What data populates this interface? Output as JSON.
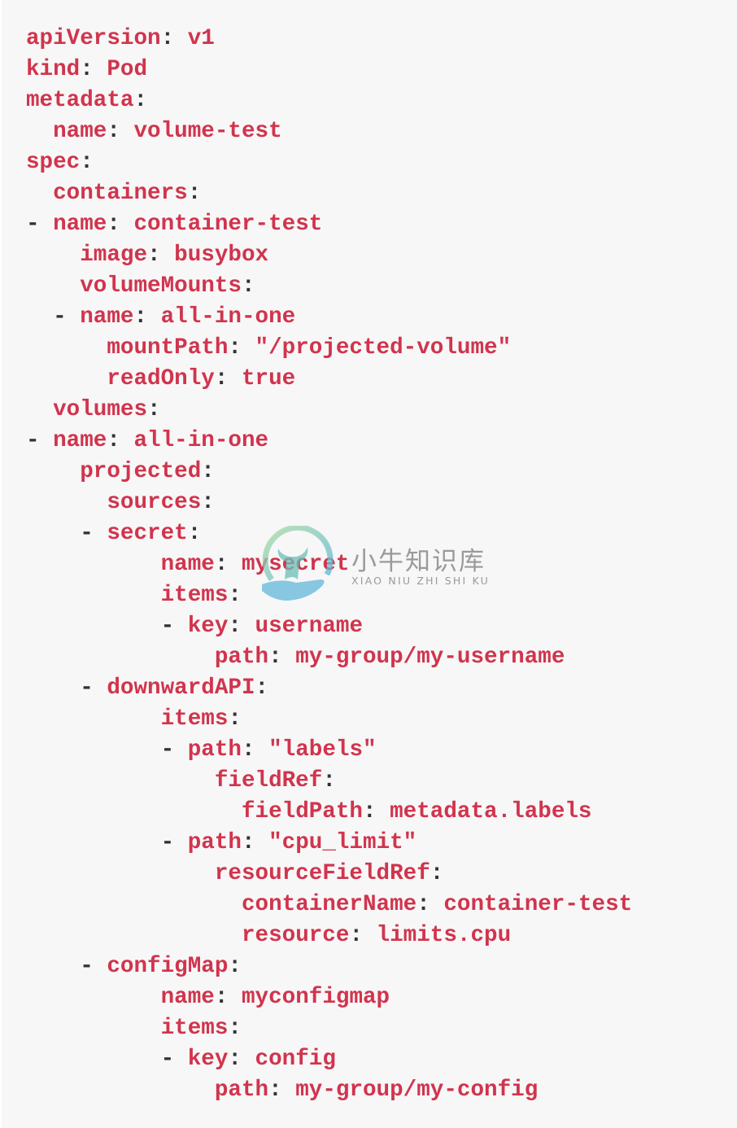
{
  "colors": {
    "key": "#d1344d",
    "value": "#d1344d",
    "punctuation": "#333333",
    "background": "#f7f7f7"
  },
  "code_lines": [
    {
      "indent": 0,
      "dash": false,
      "key": "apiVersion",
      "value": "v1"
    },
    {
      "indent": 0,
      "dash": false,
      "key": "kind",
      "value": "Pod"
    },
    {
      "indent": 0,
      "dash": false,
      "key": "metadata",
      "value": ""
    },
    {
      "indent": 2,
      "dash": false,
      "key": "name",
      "value": "volume-test"
    },
    {
      "indent": 0,
      "dash": false,
      "key": "spec",
      "value": ""
    },
    {
      "indent": 2,
      "dash": false,
      "key": "containers",
      "value": ""
    },
    {
      "indent": 2,
      "dash": true,
      "key": "name",
      "value": "container-test"
    },
    {
      "indent": 4,
      "dash": false,
      "key": "image",
      "value": "busybox"
    },
    {
      "indent": 4,
      "dash": false,
      "key": "volumeMounts",
      "value": ""
    },
    {
      "indent": 4,
      "dash": true,
      "key": "name",
      "value": "all-in-one"
    },
    {
      "indent": 6,
      "dash": false,
      "key": "mountPath",
      "value": "\"/projected-volume\""
    },
    {
      "indent": 6,
      "dash": false,
      "key": "readOnly",
      "value": "true"
    },
    {
      "indent": 2,
      "dash": false,
      "key": "volumes",
      "value": ""
    },
    {
      "indent": 2,
      "dash": true,
      "key": "name",
      "value": "all-in-one"
    },
    {
      "indent": 4,
      "dash": false,
      "key": "projected",
      "value": ""
    },
    {
      "indent": 6,
      "dash": false,
      "key": "sources",
      "value": ""
    },
    {
      "indent": 6,
      "dash": true,
      "key": "secret",
      "value": ""
    },
    {
      "indent": 10,
      "dash": false,
      "key": "name",
      "value": "mysecret"
    },
    {
      "indent": 10,
      "dash": false,
      "key": "items",
      "value": ""
    },
    {
      "indent": 12,
      "dash": true,
      "key": "key",
      "value": "username"
    },
    {
      "indent": 14,
      "dash": false,
      "key": "path",
      "value": "my-group/my-username"
    },
    {
      "indent": 6,
      "dash": true,
      "key": "downwardAPI",
      "value": ""
    },
    {
      "indent": 10,
      "dash": false,
      "key": "items",
      "value": ""
    },
    {
      "indent": 12,
      "dash": true,
      "key": "path",
      "value": "\"labels\""
    },
    {
      "indent": 14,
      "dash": false,
      "key": "fieldRef",
      "value": ""
    },
    {
      "indent": 16,
      "dash": false,
      "key": "fieldPath",
      "value": "metadata.labels"
    },
    {
      "indent": 12,
      "dash": true,
      "key": "path",
      "value": "\"cpu_limit\""
    },
    {
      "indent": 14,
      "dash": false,
      "key": "resourceFieldRef",
      "value": ""
    },
    {
      "indent": 16,
      "dash": false,
      "key": "containerName",
      "value": "container-test"
    },
    {
      "indent": 16,
      "dash": false,
      "key": "resource",
      "value": "limits.cpu"
    },
    {
      "indent": 6,
      "dash": true,
      "key": "configMap",
      "value": ""
    },
    {
      "indent": 10,
      "dash": false,
      "key": "name",
      "value": "myconfigmap"
    },
    {
      "indent": 10,
      "dash": false,
      "key": "items",
      "value": ""
    },
    {
      "indent": 12,
      "dash": true,
      "key": "key",
      "value": "config"
    },
    {
      "indent": 14,
      "dash": false,
      "key": "path",
      "value": "my-group/my-config"
    }
  ],
  "watermark": {
    "logo_icon": "bull-in-hand-logo-icon",
    "title": "小牛知识库",
    "subtitle": "XIAO NIU ZHI SHI KU"
  }
}
